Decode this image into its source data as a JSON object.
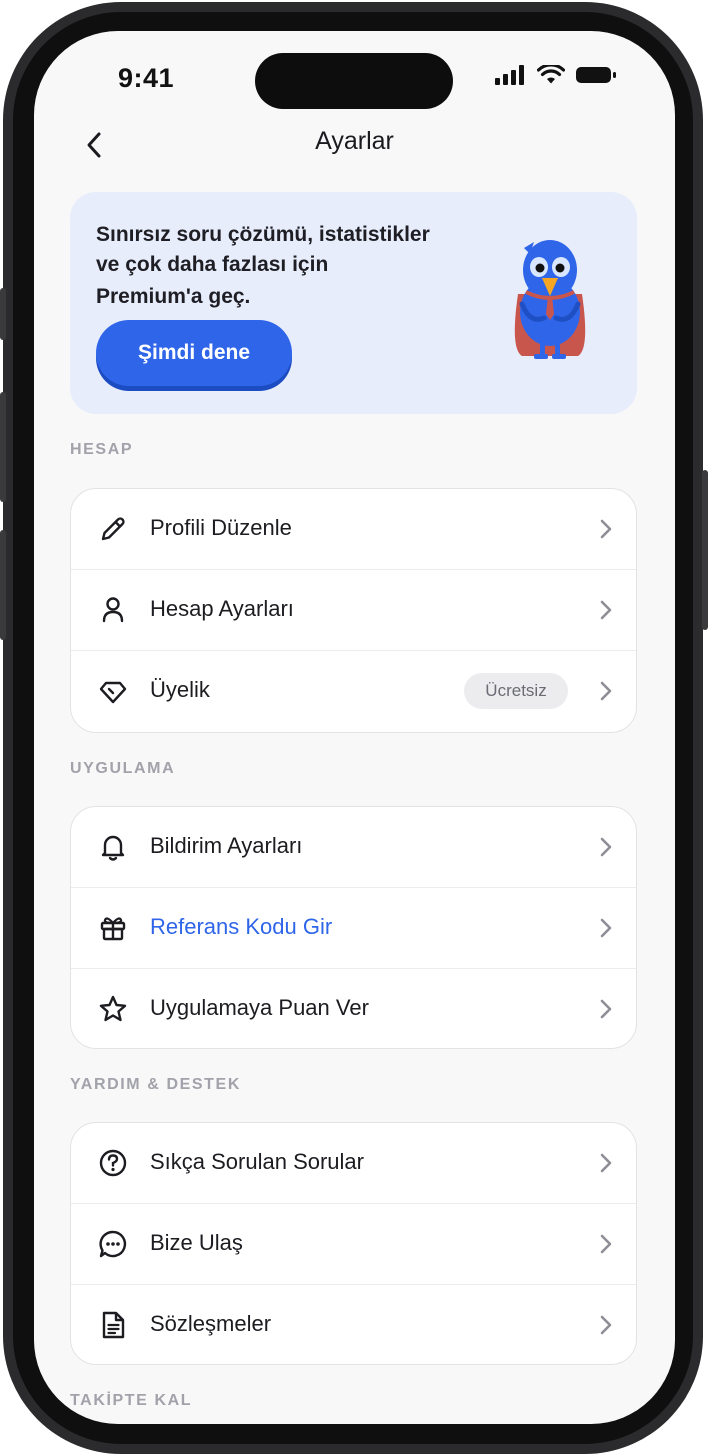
{
  "status_bar": {
    "time": "9:41"
  },
  "header": {
    "title": "Ayarlar"
  },
  "promo": {
    "text_line1": "Sınırsız soru çözümü, istatistikler",
    "text_line2": "ve çok daha fazlası için",
    "text_line3": "Premium'a geç.",
    "button_label": "Şimdi dene"
  },
  "sections": {
    "account": {
      "label": "HESAP",
      "items": [
        {
          "label": "Profili Düzenle",
          "icon": "pencil-icon"
        },
        {
          "label": "Hesap Ayarları",
          "icon": "user-icon"
        },
        {
          "label": "Üyelik",
          "icon": "diamond-icon",
          "badge": "Ücretsiz"
        }
      ]
    },
    "app": {
      "label": "UYGULAMA",
      "items": [
        {
          "label": "Bildirim Ayarları",
          "icon": "bell-icon"
        },
        {
          "label": "Referans Kodu Gir",
          "icon": "gift-icon",
          "accent": true
        },
        {
          "label": "Uygulamaya Puan Ver",
          "icon": "star-icon"
        }
      ]
    },
    "support": {
      "label": "YARDIM & DESTEK",
      "items": [
        {
          "label": "Sıkça Sorulan Sorular",
          "icon": "question-circle-icon"
        },
        {
          "label": "Bize Ulaş",
          "icon": "chat-bubble-icon"
        },
        {
          "label": "Sözleşmeler",
          "icon": "document-icon"
        }
      ]
    },
    "follow": {
      "label": "TAKİPTE KAL"
    }
  },
  "colors": {
    "accent": "#2f66e9",
    "promo_bg": "#e7edfb",
    "section_label": "#a2a2aa"
  }
}
